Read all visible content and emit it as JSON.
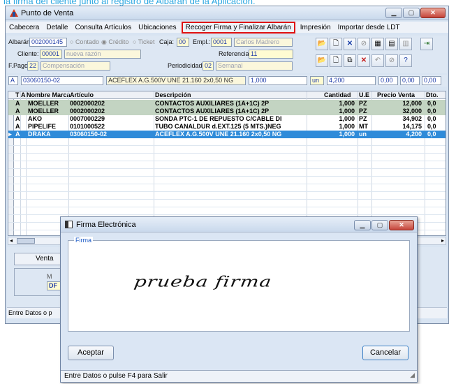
{
  "caption": "la firma del cliente junto al registro de Albarán de la Aplicación.",
  "window": {
    "title": "Punto de Venta"
  },
  "menu": [
    "Cabecera",
    "Detalle",
    "Consulta Artículos",
    "Ubicaciones",
    "Recoger Firma y Finalizar Albarán",
    "Impresión",
    "Importar desde LDT"
  ],
  "form": {
    "albaran_label": "Albarán:",
    "albaran_value": "002000145",
    "contado": "Contado",
    "credito": "Crédito",
    "ticket": "Ticket",
    "caja_label": "Caja:",
    "caja_value": "00",
    "empl_label": "Empl.:",
    "empl_code": "0001",
    "empl_name": "Carlos Madrero",
    "cliente_label": "Cliente:",
    "cliente_code": "00001",
    "cliente_name": "nueva razón",
    "referencia_label": "Referencia:",
    "referencia_value": "11",
    "fpago_label": "F.Pago:",
    "fpago_code": "22",
    "fpago_name": "Compensación",
    "periodicidad_label": "Periodicidad:",
    "periodicidad_code": "02",
    "periodicidad_name": "Semanal"
  },
  "entry": {
    "tipo": "A",
    "articulo": "03060150-02",
    "descripcion": "ACEFLEX A.G.500V UNE 21.160 2x0,50 NG",
    "cantidad": "1,000",
    "ue": "un",
    "precio": "4,200",
    "dto1": "0,00",
    "dto2": "0,00",
    "dto3": "0,00"
  },
  "grid": {
    "headers": [
      "T",
      "A",
      "Nombre Marca",
      "Artículo",
      "Descripción",
      "Cantidad",
      "U.E",
      "Precio Venta",
      "Dto."
    ],
    "rows": [
      {
        "t": "A",
        "a": "",
        "marca": "MOELLER",
        "articulo": "0002000202",
        "desc": "CONTACTOS AUXILIARES (1A+1C) 2P",
        "cant": "1,000",
        "ue": "PZ",
        "precio": "12,000",
        "dto": "0,0"
      },
      {
        "t": "A",
        "a": "",
        "marca": "MOELLER",
        "articulo": "0002000202",
        "desc": "CONTACTOS AUXILIARES (1A+1C) 2P",
        "cant": "1,000",
        "ue": "PZ",
        "precio": "32,000",
        "dto": "0,0"
      },
      {
        "t": "A",
        "a": "",
        "marca": "AKO",
        "articulo": "0007000229",
        "desc": "SONDA PTC-1 DE REPUESTO C/CABLE DI",
        "cant": "1,000",
        "ue": "PZ",
        "precio": "34,902",
        "dto": "0,0"
      },
      {
        "t": "A",
        "a": "",
        "marca": "PIPELIFE",
        "articulo": "0101000522",
        "desc": "TUBO CANALDUR d.EXT.125 (5 MTS.)NEG",
        "cant": "1,000",
        "ue": "MT",
        "precio": "14,175",
        "dto": "0,0"
      },
      {
        "t": "A",
        "a": "",
        "marca": "DRAKA",
        "articulo": "03060150-02",
        "desc": "ACEFLEX A.G.500V UNE 21.160 2x0,50 NG",
        "cant": "1,000",
        "ue": "un",
        "precio": "4,200",
        "dto": "0,0"
      }
    ]
  },
  "bottom": {
    "venta_label": "Venta",
    "m_label": "M",
    "df_label": "DF"
  },
  "status": "Entre Datos o p",
  "dialog": {
    "title": "Firma Electrónica",
    "group_label": "Firma",
    "signature": "prueba firma",
    "accept": "Aceptar",
    "cancel": "Cancelar",
    "status": "Entre Datos o pulse F4 para Salir"
  }
}
